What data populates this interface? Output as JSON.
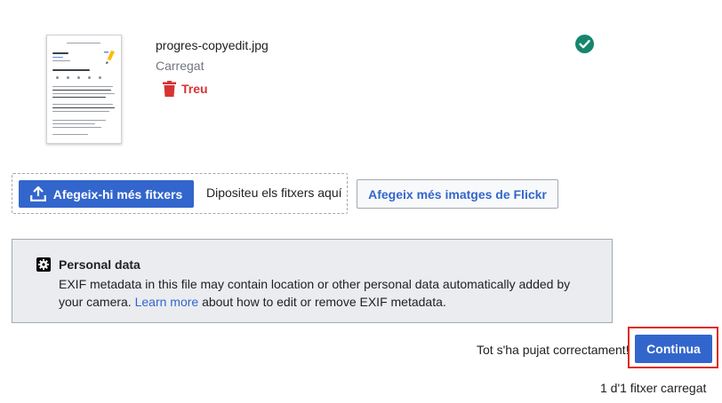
{
  "upload": {
    "file_name": "progres-copyedit.jpg",
    "status": "Carregat",
    "remove_label": "Treu",
    "success_icon": "check-circle-icon",
    "success_color": "#14866d"
  },
  "dropzone": {
    "add_files_label": "Afegeix-hi més fitxers",
    "drop_text": "Dipositeu els fitxers aquí",
    "flickr_label": "Afegeix més imatges de Flickr"
  },
  "notice": {
    "title": "Personal data",
    "body_before": "EXIF metadata in this file may contain location or other personal data automatically added by your camera. ",
    "link": "Learn more",
    "body_after": " about how to edit or remove EXIF metadata."
  },
  "footer": {
    "success_text": "Tot s'ha pujat correctament!",
    "continue_label": "Continua",
    "count_text": "1 d'1 fitxer carregat"
  },
  "colors": {
    "accent": "#3366cc",
    "danger": "#d73333",
    "highlight_border": "#e1291c"
  }
}
